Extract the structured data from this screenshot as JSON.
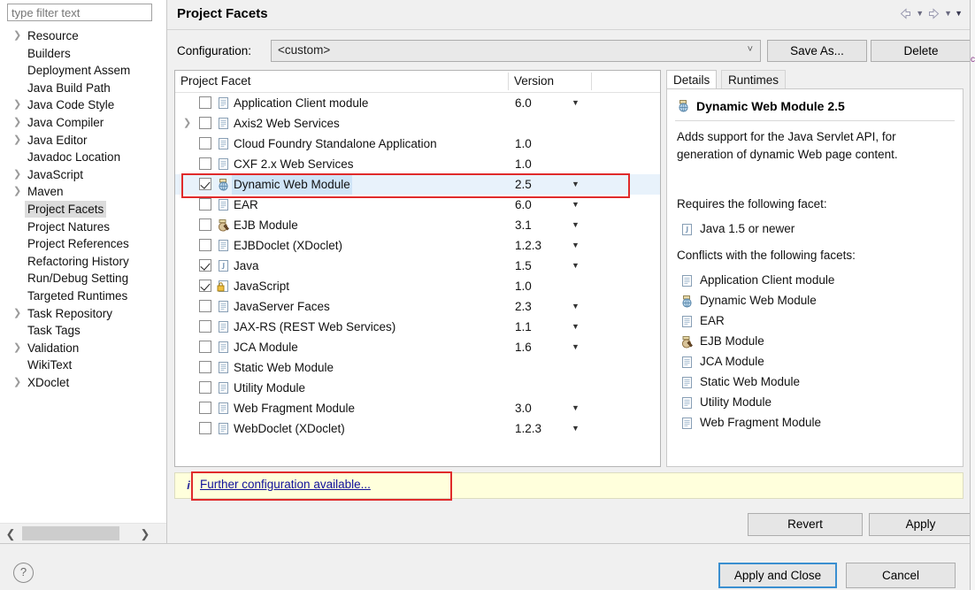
{
  "window": {
    "title": "Project Facets",
    "filter_placeholder": "type filter text",
    "filter_value": ""
  },
  "nav": {
    "back_icon": "back-arrow-icon",
    "back_menu_icon": "chevron-down-icon",
    "forward_icon": "forward-arrow-icon",
    "forward_menu_icon": "chevron-down-icon",
    "view_menu_icon": "chevron-down-icon"
  },
  "sidebar": {
    "items": [
      {
        "label": "Resource",
        "expandable": true,
        "selected": false
      },
      {
        "label": "Builders",
        "expandable": false,
        "selected": false
      },
      {
        "label": "Deployment Assem",
        "expandable": false,
        "selected": false
      },
      {
        "label": "Java Build Path",
        "expandable": false,
        "selected": false
      },
      {
        "label": "Java Code Style",
        "expandable": true,
        "selected": false
      },
      {
        "label": "Java Compiler",
        "expandable": true,
        "selected": false
      },
      {
        "label": "Java Editor",
        "expandable": true,
        "selected": false
      },
      {
        "label": "Javadoc Location",
        "expandable": false,
        "selected": false
      },
      {
        "label": "JavaScript",
        "expandable": true,
        "selected": false
      },
      {
        "label": "Maven",
        "expandable": true,
        "selected": false
      },
      {
        "label": "Project Facets",
        "expandable": false,
        "selected": true
      },
      {
        "label": "Project Natures",
        "expandable": false,
        "selected": false
      },
      {
        "label": "Project References",
        "expandable": false,
        "selected": false
      },
      {
        "label": "Refactoring History",
        "expandable": false,
        "selected": false
      },
      {
        "label": "Run/Debug Setting",
        "expandable": false,
        "selected": false
      },
      {
        "label": "Targeted Runtimes",
        "expandable": false,
        "selected": false
      },
      {
        "label": "Task Repository",
        "expandable": true,
        "selected": false
      },
      {
        "label": "Task Tags",
        "expandable": false,
        "selected": false
      },
      {
        "label": "Validation",
        "expandable": true,
        "selected": false
      },
      {
        "label": "WikiText",
        "expandable": false,
        "selected": false
      },
      {
        "label": "XDoclet",
        "expandable": true,
        "selected": false
      }
    ],
    "scroll_left_icon": "chevron-left-icon",
    "scroll_right_icon": "chevron-right-icon"
  },
  "config": {
    "label": "Configuration:",
    "value": "<custom>",
    "dropdown_icon": "chevron-down-icon",
    "save_as_label": "Save As...",
    "delete_label": "Delete"
  },
  "facet_table": {
    "columns": [
      "Project Facet",
      "Version"
    ],
    "rows": [
      {
        "name": "Application Client module",
        "version": "6.0",
        "checked": false,
        "expandable": false,
        "has_version_menu": true,
        "icon": "page-icon",
        "selected": false
      },
      {
        "name": "Axis2 Web Services",
        "version": "",
        "checked": false,
        "expandable": true,
        "has_version_menu": false,
        "icon": "page-icon",
        "selected": false
      },
      {
        "name": "Cloud Foundry Standalone Application",
        "version": "1.0",
        "checked": false,
        "expandable": false,
        "has_version_menu": false,
        "icon": "page-icon",
        "selected": false
      },
      {
        "name": "CXF 2.x Web Services",
        "version": "1.0",
        "checked": false,
        "expandable": false,
        "has_version_menu": false,
        "icon": "page-icon",
        "selected": false
      },
      {
        "name": "Dynamic Web Module",
        "version": "2.5",
        "checked": true,
        "expandable": false,
        "has_version_menu": true,
        "icon": "web-module-icon",
        "selected": true
      },
      {
        "name": "EAR",
        "version": "6.0",
        "checked": false,
        "expandable": false,
        "has_version_menu": true,
        "icon": "page-icon",
        "selected": false
      },
      {
        "name": "EJB Module",
        "version": "3.1",
        "checked": false,
        "expandable": false,
        "has_version_menu": true,
        "icon": "ejb-icon",
        "selected": false
      },
      {
        "name": "EJBDoclet (XDoclet)",
        "version": "1.2.3",
        "checked": false,
        "expandable": false,
        "has_version_menu": true,
        "icon": "page-icon",
        "selected": false
      },
      {
        "name": "Java",
        "version": "1.5",
        "checked": true,
        "expandable": false,
        "has_version_menu": true,
        "icon": "java-icon",
        "selected": false
      },
      {
        "name": "JavaScript",
        "version": "1.0",
        "checked": true,
        "expandable": false,
        "has_version_menu": false,
        "icon": "javascript-icon",
        "selected": false
      },
      {
        "name": "JavaServer Faces",
        "version": "2.3",
        "checked": false,
        "expandable": false,
        "has_version_menu": true,
        "icon": "page-icon",
        "selected": false
      },
      {
        "name": "JAX-RS (REST Web Services)",
        "version": "1.1",
        "checked": false,
        "expandable": false,
        "has_version_menu": true,
        "icon": "page-icon",
        "selected": false
      },
      {
        "name": "JCA Module",
        "version": "1.6",
        "checked": false,
        "expandable": false,
        "has_version_menu": true,
        "icon": "page-icon",
        "selected": false
      },
      {
        "name": "Static Web Module",
        "version": "",
        "checked": false,
        "expandable": false,
        "has_version_menu": false,
        "icon": "page-icon",
        "selected": false
      },
      {
        "name": "Utility Module",
        "version": "",
        "checked": false,
        "expandable": false,
        "has_version_menu": false,
        "icon": "page-icon",
        "selected": false
      },
      {
        "name": "Web Fragment Module",
        "version": "3.0",
        "checked": false,
        "expandable": false,
        "has_version_menu": true,
        "icon": "page-icon",
        "selected": false
      },
      {
        "name": "WebDoclet (XDoclet)",
        "version": "1.2.3",
        "checked": false,
        "expandable": false,
        "has_version_menu": true,
        "icon": "page-icon",
        "selected": false
      }
    ]
  },
  "details": {
    "tabs": [
      {
        "label": "Details",
        "active": true
      },
      {
        "label": "Runtimes",
        "active": false
      }
    ],
    "title": "Dynamic Web Module 2.5",
    "title_icon": "web-module-icon",
    "description": "Adds support for the Java Servlet API, for generation of dynamic Web page content.",
    "requires_heading": "Requires the following facet:",
    "requires": [
      {
        "label": "Java 1.5 or newer",
        "icon": "java-icon"
      }
    ],
    "conflicts_heading": "Conflicts with the following facets:",
    "conflicts": [
      {
        "label": "Application Client module",
        "icon": "page-icon"
      },
      {
        "label": "Dynamic Web Module",
        "icon": "web-module-icon"
      },
      {
        "label": "EAR",
        "icon": "page-icon"
      },
      {
        "label": "EJB Module",
        "icon": "ejb-icon"
      },
      {
        "label": "JCA Module",
        "icon": "page-icon"
      },
      {
        "label": "Static Web Module",
        "icon": "page-icon"
      },
      {
        "label": "Utility Module",
        "icon": "page-icon"
      },
      {
        "label": "Web Fragment Module",
        "icon": "page-icon"
      }
    ]
  },
  "info_bar": {
    "icon": "info-icon",
    "link_label": "Further configuration available..."
  },
  "buttons": {
    "revert": "Revert",
    "apply": "Apply",
    "apply_and_close": "Apply and Close",
    "cancel": "Cancel"
  },
  "footer": {
    "help_icon": "help-icon",
    "help_glyph": "?"
  },
  "colors": {
    "annotation_red": "#e02b2b",
    "selection_blue": "#cfe4f7",
    "info_yellow": "#ffffdc",
    "default_button_border": "#3a8fd0",
    "link_blue": "#10109a"
  }
}
